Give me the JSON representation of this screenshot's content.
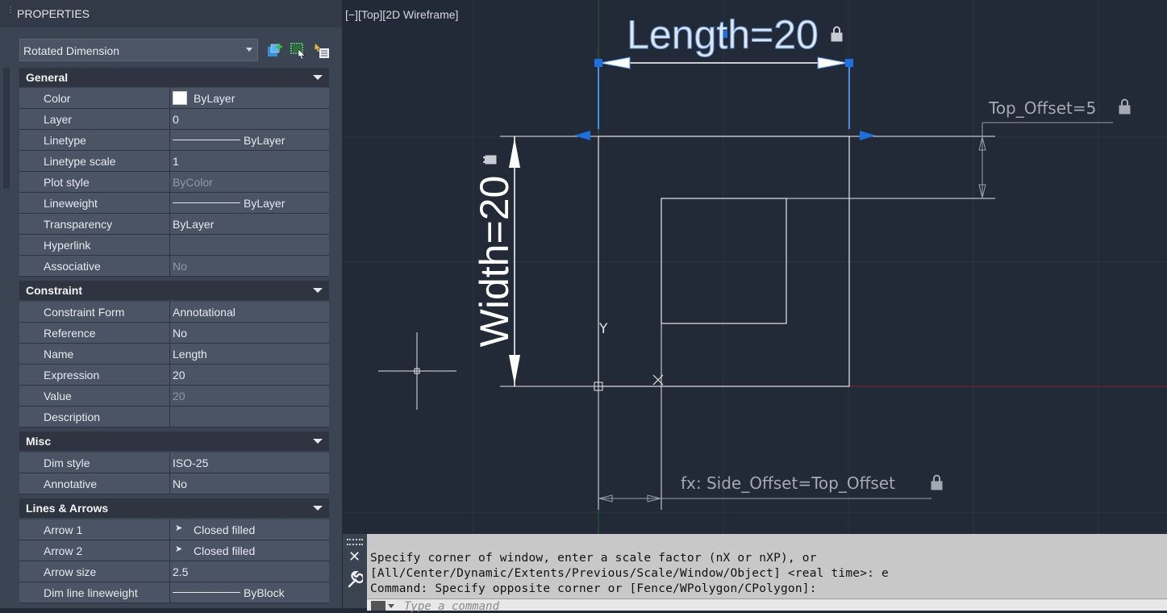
{
  "properties": {
    "title": "PROPERTIES",
    "selected_type": "Rotated Dimension",
    "sections": {
      "general": {
        "label": "General",
        "rows": [
          {
            "key": "Color",
            "value": "ByLayer"
          },
          {
            "key": "Layer",
            "value": "0"
          },
          {
            "key": "Linetype",
            "value": "ByLayer"
          },
          {
            "key": "Linetype scale",
            "value": "1"
          },
          {
            "key": "Plot style",
            "value": "ByColor"
          },
          {
            "key": "Lineweight",
            "value": "ByLayer"
          },
          {
            "key": "Transparency",
            "value": "ByLayer"
          },
          {
            "key": "Hyperlink",
            "value": ""
          },
          {
            "key": "Associative",
            "value": "No"
          }
        ]
      },
      "constraint": {
        "label": "Constraint",
        "rows": [
          {
            "key": "Constraint Form",
            "value": "Annotational"
          },
          {
            "key": "Reference",
            "value": "No"
          },
          {
            "key": "Name",
            "value": "Length"
          },
          {
            "key": "Expression",
            "value": "20"
          },
          {
            "key": "Value",
            "value": "20"
          },
          {
            "key": "Description",
            "value": ""
          }
        ]
      },
      "misc": {
        "label": "Misc",
        "rows": [
          {
            "key": "Dim style",
            "value": "ISO-25"
          },
          {
            "key": "Annotative",
            "value": "No"
          }
        ]
      },
      "lines_arrows": {
        "label": "Lines & Arrows",
        "rows": [
          {
            "key": "Arrow 1",
            "value": "Closed filled"
          },
          {
            "key": "Arrow 2",
            "value": "Closed filled"
          },
          {
            "key": "Arrow size",
            "value": "2.5"
          },
          {
            "key": "Dim line lineweight",
            "value": "ByBlock"
          }
        ]
      }
    },
    "toolbar_icons": [
      "quick-select-icon",
      "select-objects-icon",
      "toggle-pickadd-icon"
    ]
  },
  "viewport": {
    "label": "[−][Top][2D Wireframe]",
    "annotations": {
      "length": "Length=20",
      "width": "Width=20",
      "top_offset": "Top_Offset=5",
      "side_offset": "fx: Side_Offset=Top_Offset",
      "ucs_y": "Y"
    },
    "colors": {
      "background": "#212a36",
      "geometry": "#e6e6e6",
      "selected": "#4a8fe0",
      "grip": "#1e6fe0",
      "x_axis": "#8a2020",
      "y_axis": "#1f6a2a"
    }
  },
  "command_line": {
    "lines": [
      "Specify corner of window, enter a scale factor (nX or nXP), or",
      "[All/Center/Dynamic/Extents/Previous/Scale/Window/Object] <real time>: e",
      "Command: Specify opposite corner or [Fence/WPolygon/CPolygon]:"
    ],
    "placeholder": "Type a command",
    "close_icon": "✕"
  }
}
